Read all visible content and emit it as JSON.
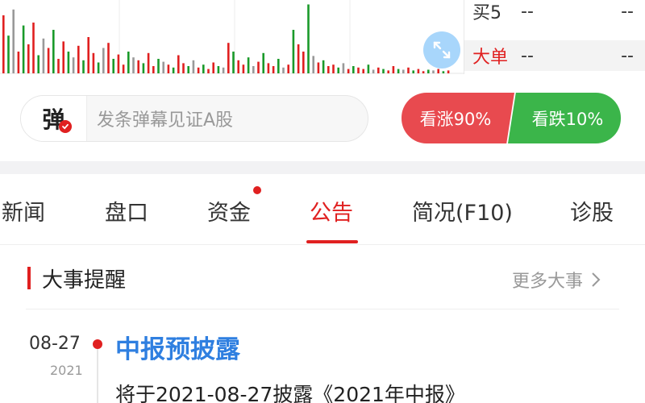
{
  "chart_data": {
    "type": "bar",
    "title": "",
    "xlabel": "",
    "ylabel": "",
    "series": [
      {
        "values": [
          80,
          52,
          88,
          30,
          66,
          40,
          70,
          25,
          48,
          35,
          60,
          20,
          44,
          30,
          22,
          38,
          18,
          50,
          28,
          15,
          35,
          42,
          20,
          26,
          12,
          30,
          22,
          18,
          14,
          28,
          10,
          20,
          16,
          12,
          8,
          25,
          14,
          10,
          18,
          8,
          12,
          6,
          15,
          10,
          8,
          42,
          30,
          18,
          12,
          22,
          10,
          16,
          28,
          14,
          10,
          20,
          8,
          12,
          60,
          40,
          30,
          95,
          24,
          15,
          18,
          10,
          12,
          8,
          14,
          6,
          10,
          8,
          6,
          12,
          5,
          8,
          6,
          4,
          10,
          6,
          5,
          8,
          4,
          6,
          3,
          5,
          4,
          6,
          3,
          4
        ]
      }
    ],
    "colors": {
      "up": "#e02020",
      "down": "#1a9a2a",
      "flat": "#999999"
    }
  },
  "order_book": {
    "sell5_label": "买5",
    "sell5_price": "--",
    "sell5_vol": "--",
    "big_label": "大单",
    "big_price": "--",
    "big_vol": "--"
  },
  "expand_icon": "expand-arrows-icon",
  "danmaku": {
    "icon_char": "弹",
    "placeholder": "发条弹幕见证A股"
  },
  "vote": {
    "up_label": "看涨90%",
    "down_label": "看跌10%",
    "up_color": "#e84a4f",
    "down_color": "#3bb54a"
  },
  "tabs": [
    {
      "label": "新闻"
    },
    {
      "label": "盘口"
    },
    {
      "label": "资金"
    },
    {
      "label": "公告"
    },
    {
      "label": "简况(F10)"
    },
    {
      "label": "诊股"
    }
  ],
  "events": {
    "title": "大事提醒",
    "more_label": "更多大事",
    "items": [
      {
        "date": "08-27",
        "year": "2021",
        "title": "中报预披露",
        "desc": "将于2021-08-27披露《2021年中报》"
      }
    ]
  },
  "colors": {
    "accent_red": "#e02020",
    "link_blue": "#2f7fe0"
  }
}
